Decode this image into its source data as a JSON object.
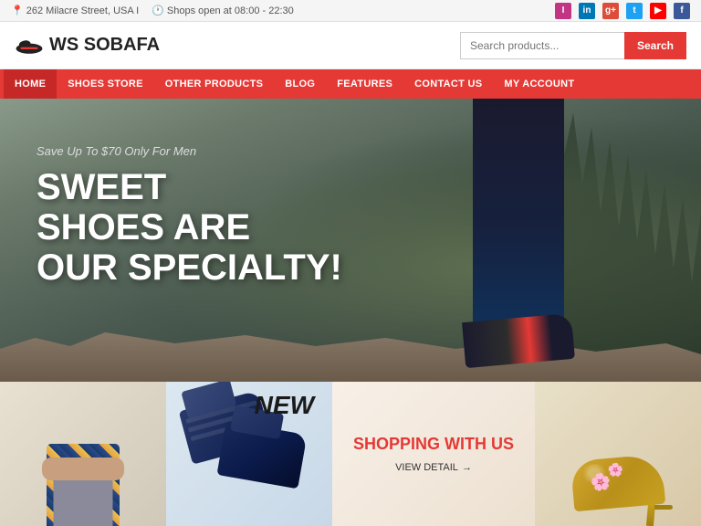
{
  "topbar": {
    "address": "262 Milacre Street, USA I",
    "hours": "Shops open at 08:00 - 22:30",
    "social": [
      {
        "name": "instagram",
        "label": "I"
      },
      {
        "name": "linkedin",
        "label": "in"
      },
      {
        "name": "google",
        "label": "g+"
      },
      {
        "name": "twitter",
        "label": "t"
      },
      {
        "name": "youtube",
        "label": "▶"
      },
      {
        "name": "facebook",
        "label": "f"
      }
    ]
  },
  "header": {
    "logo_text": "WS SOBAFA",
    "search_placeholder": "Search products...",
    "search_button": "Search"
  },
  "nav": {
    "items": [
      {
        "label": "HOME",
        "active": true
      },
      {
        "label": "SHOES STORE",
        "active": false
      },
      {
        "label": "OTHER PRODUCTS",
        "active": false
      },
      {
        "label": "BLOG",
        "active": false
      },
      {
        "label": "FEATURES",
        "active": false
      },
      {
        "label": "CONTACT US",
        "active": false
      },
      {
        "label": "MY ACCOUNT",
        "active": false
      }
    ]
  },
  "hero": {
    "subtitle": "Save Up To $70 Only For Men",
    "title_line1": "SWEET",
    "title_line2": "SHOES ARE",
    "title_line3": "OUR SPECIALTY!"
  },
  "bottom": {
    "new_badge": "NEW",
    "shopping_title": "SHOPPING WITH US",
    "view_detail": "VIEW DETAIL"
  }
}
